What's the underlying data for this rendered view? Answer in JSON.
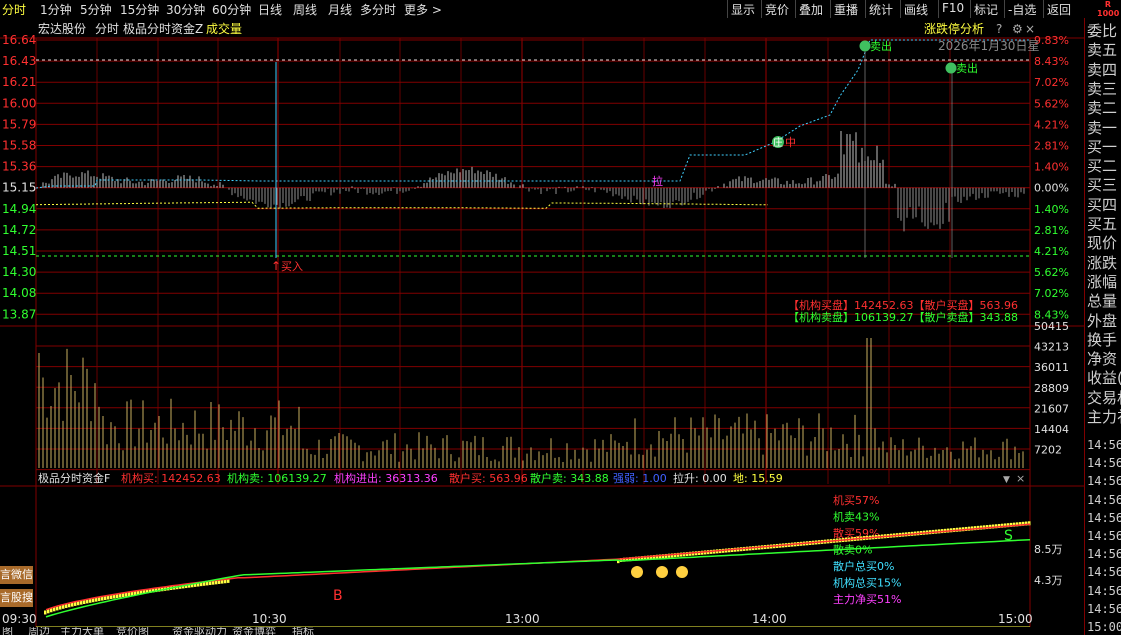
{
  "period_tabs": [
    "分时",
    "1分钟",
    "5分钟",
    "15分钟",
    "30分钟",
    "60分钟",
    "日线",
    "周线",
    "月线",
    "多分时",
    "更多 >"
  ],
  "toolbar_buttons": [
    "显示",
    "竞价",
    "叠加",
    "重播",
    "统计",
    "画线",
    "F10",
    "标记",
    "-自选",
    "返回"
  ],
  "logo_text": [
    "R",
    "1000"
  ],
  "header": {
    "stock_name": "宏达股份",
    "view": "分时",
    "indicator": "极品分时资金Z",
    "volume_label": "成交量",
    "analysis_link": "涨跌停分析",
    "date_text": "2026年1月30日星"
  },
  "price_axis": {
    "left": [
      "16.64",
      "16.43",
      "16.21",
      "16.00",
      "15.79",
      "15.58",
      "15.36",
      "15.15",
      "14.94",
      "14.72",
      "14.51",
      "14.30",
      "14.08",
      "13.87"
    ],
    "right": [
      "9.83%",
      "8.43%",
      "7.02%",
      "5.62%",
      "4.21%",
      "2.81%",
      "1.40%",
      "0.00%",
      "1.40%",
      "2.81%",
      "4.21%",
      "5.62%",
      "7.02%",
      "8.43%"
    ]
  },
  "volume_axis": [
    "50415",
    "43213",
    "36011",
    "28809",
    "21607",
    "14404",
    "7202"
  ],
  "markers": {
    "buy": "买入",
    "sell": "卖出",
    "zhuang_char": "庄",
    "zhong_char": "中",
    "la": "拉",
    "B": "B",
    "S": "S"
  },
  "info_box": {
    "row1": "【机构买盘】142452.63【散户买盘】563.96",
    "row2": "【机构卖盘】106139.27【散户卖盘】343.88"
  },
  "indicator_line": {
    "name": "极品分时资金F",
    "fields": [
      {
        "label": "机构买: 142452.63",
        "color": "#ff3030"
      },
      {
        "label": "机构卖: 106139.27",
        "color": "#30ff30"
      },
      {
        "label": "机构进出: 36313.36",
        "color": "#ff40ff"
      },
      {
        "label": "散户买: 563.96",
        "color": "#ff3030"
      },
      {
        "label": "散户卖: 343.88",
        "color": "#30ff30"
      },
      {
        "label": "强弱: 1.00",
        "color": "#4060ff"
      },
      {
        "label": "拉升: 0.00",
        "color": "#e0e0e0"
      },
      {
        "label": "地: 15.59",
        "color": "#ffff40"
      }
    ]
  },
  "indicator_legend": [
    {
      "text": "机买57%",
      "color": "#ff3030"
    },
    {
      "text": "机卖43%",
      "color": "#30ff30"
    },
    {
      "text": "散买59%",
      "color": "#ff3030"
    },
    {
      "text": "散卖0%",
      "color": "#30ff30"
    },
    {
      "text": "散户总买0%",
      "color": "#40e0ff"
    },
    {
      "text": "机构总买15%",
      "color": "#40e0ff"
    },
    {
      "text": "主力净买51%",
      "color": "#ff40ff"
    }
  ],
  "indicator_axis": [
    "8.5万",
    "4.3万"
  ],
  "time_axis": [
    "09:30",
    "10:30",
    "13:00",
    "14:00",
    "15:00"
  ],
  "side_buttons": [
    "言微信",
    "言股搜"
  ],
  "right_panel": {
    "labels": [
      "委比",
      "卖五",
      "卖四",
      "卖三",
      "卖二",
      "卖一",
      "买一",
      "买二",
      "买三",
      "买四",
      "买五",
      "现价",
      "涨跌",
      "涨幅",
      "总量",
      "外盘",
      "换手",
      "净资",
      "收益(",
      "交易材",
      "主力祁"
    ],
    "times": [
      "14:56",
      "14:56",
      "14:56",
      "14:56",
      "14:56",
      "14:56",
      "14:56",
      "14:56",
      "14:56",
      "14:56",
      "15:00"
    ]
  },
  "bottom_tabs": [
    "图",
    "周边",
    "主力大单",
    "竞价图",
    "资金驱动力",
    "资金博弈",
    "指标"
  ],
  "colors": {
    "grid": "#800000",
    "up": "#ff3030",
    "down": "#30ff30",
    "price_line": "#40d0ff",
    "avg_line": "#ffff40",
    "volume": "#c8b060"
  }
}
